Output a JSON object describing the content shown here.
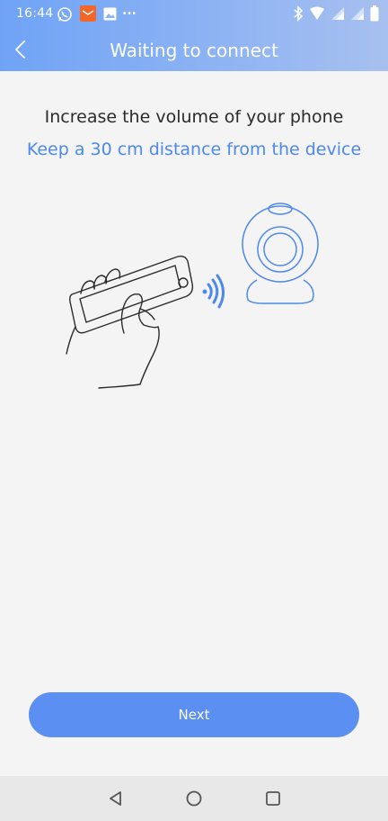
{
  "status_bar": {
    "time": "16:44",
    "more_indicator": "...",
    "left_icons": [
      "whatsapp-icon",
      "mail-app-icon",
      "gallery-icon"
    ],
    "right_icons": [
      "bluetooth-icon",
      "wifi-icon",
      "signal-icon",
      "signal-icon",
      "battery-icon"
    ]
  },
  "app_bar": {
    "title": "Waiting to connect",
    "back_icon": "chevron-left-icon"
  },
  "instructions": {
    "main": "Increase the volume of your phone",
    "sub": "Keep a 30 cm distance from the device"
  },
  "illustration": {
    "icons": [
      "hand-holding-phone-icon",
      "sound-waves-icon",
      "camera-device-icon"
    ]
  },
  "actions": {
    "next_label": "Next"
  },
  "nav_bar": {
    "buttons": [
      "back-triangle-icon",
      "home-circle-icon",
      "recents-square-icon"
    ]
  },
  "colors": {
    "accent": "#5b8ff2",
    "subtitle": "#4d88ec",
    "header_start": "#6fa3f6",
    "header_end": "#a7c0ef",
    "background": "#f4f4f4"
  }
}
